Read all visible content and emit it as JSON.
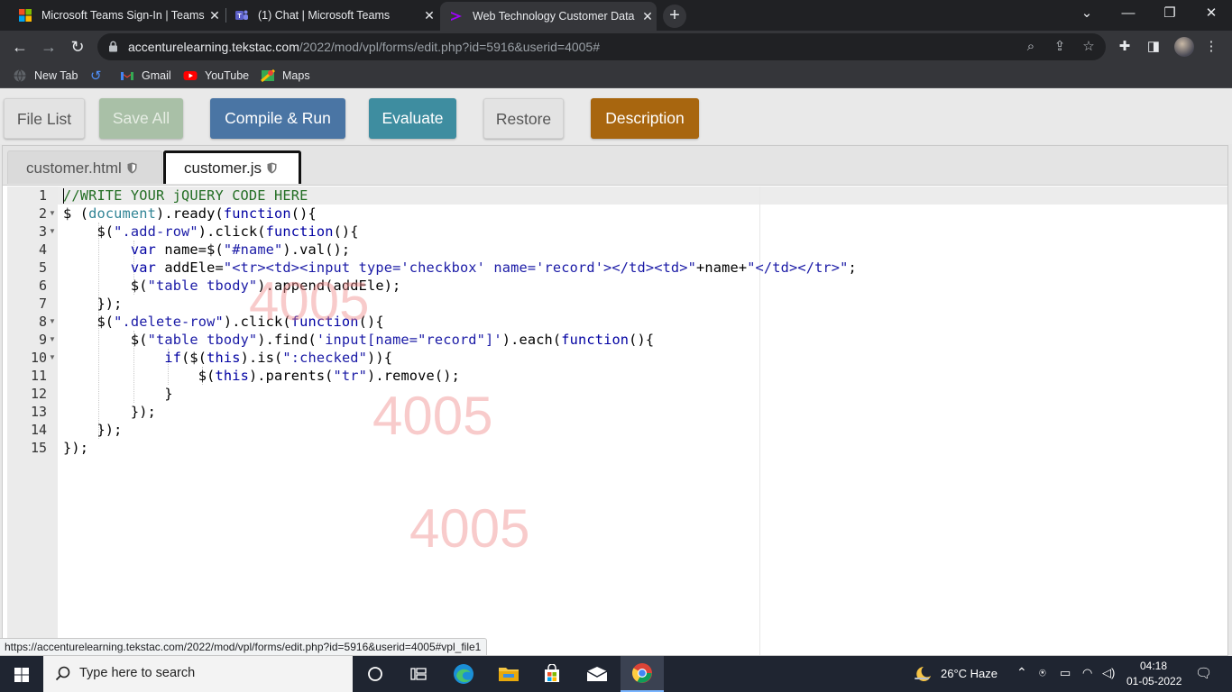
{
  "browser": {
    "tabs": [
      {
        "title": "Microsoft Teams Sign-In | Teams",
        "active": false
      },
      {
        "title": "(1) Chat | Microsoft Teams",
        "active": false
      },
      {
        "title": "Web Technology Customer Data",
        "active": true
      }
    ],
    "url_domain": "accenturelearning.tekstac.com",
    "url_path": "/2022/mod/vpl/forms/edit.php?id=5916&userid=4005#",
    "bookmarks": [
      "New Tab",
      "Gmail",
      "YouTube",
      "Maps"
    ]
  },
  "toolbar_buttons": {
    "file_list": "File List",
    "save_all": "Save All",
    "compile_run": "Compile & Run",
    "evaluate": "Evaluate",
    "restore": "Restore",
    "description": "Description"
  },
  "file_tabs": [
    {
      "name": "customer.html",
      "active": false
    },
    {
      "name": "customer.js",
      "active": true
    }
  ],
  "code": {
    "line_numbers": [
      "1",
      "2",
      "3",
      "4",
      "5",
      "6",
      "7",
      "8",
      "9",
      "10",
      "11",
      "12",
      "13",
      "14",
      "15"
    ],
    "lines": [
      "//WRITE YOUR jQUERY CODE HERE",
      "$ (document).ready(function(){",
      "    $(\".add-row\").click(function(){",
      "        var name=$(\"#name\").val();",
      "        var addEle=\"<tr><td><input type='checkbox' name='record'></td><td>\"+name+\"</td></tr>\";",
      "        $(\"table tbody\").append(addEle);",
      "    });",
      "    $(\".delete-row\").click(function(){",
      "        $(\"table tbody\").find('input[name=\"record\"]').each(function(){",
      "            if($(this).is(\":checked\")){",
      "                $(this).parents(\"tr\").remove();",
      "            }",
      "        });",
      "    });",
      "});"
    ]
  },
  "watermark": "4005",
  "status_url": "https://accenturelearning.tekstac.com/2022/mod/vpl/forms/edit.php?id=5916&userid=4005#vpl_file1",
  "taskbar": {
    "search_placeholder": "Type here to search",
    "weather": "26°C  Haze",
    "time": "04:18",
    "date": "01-05-2022"
  }
}
